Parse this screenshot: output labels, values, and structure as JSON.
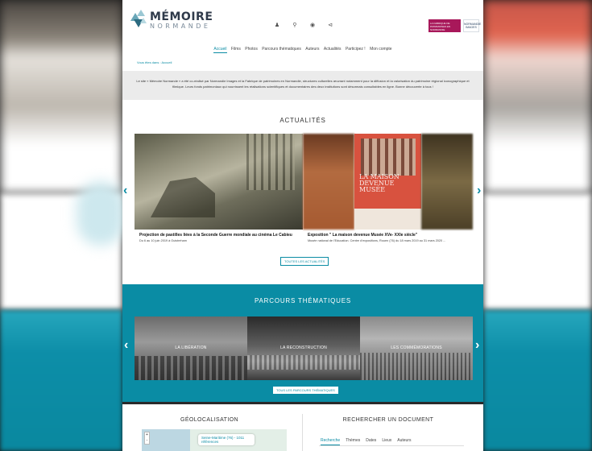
{
  "logo": {
    "title": "MÉMOIRE",
    "subtitle": "NORMANDE"
  },
  "header_icons": [
    "user-icon",
    "search-icon",
    "globe-icon",
    "share-icon"
  ],
  "partners": {
    "fabrique": "LA FABRIQUE DE PATRIMOINES EN NORMANDIE",
    "images": "NORMANDIE IMAGES"
  },
  "nav": {
    "items": [
      "Accueil",
      "Films",
      "Photos",
      "Parcours thématiques",
      "Auteurs",
      "Actualités",
      "Participez !",
      "Mon compte"
    ],
    "active": "Accueil"
  },
  "breadcrumb": {
    "prefix": "Vous êtes dans :",
    "current": "Accueil"
  },
  "intro": "Le site « Mémoire Normande » a été co-réalisé par Normandie Images et la Fabrique de patrimoines en Normandie, structures culturelles œuvrant notamment pour la diffusion et la valorisation du patrimoine régional iconographique et filmique. Leurs fonds patrimoniaux qui nourrissent les réalisations scientifiques et documentaires des deux institutions sont désormais consultables en ligne. Bonne découverte à tous !",
  "news": {
    "title": "ACTUALITÉS",
    "items": [
      {
        "title": "Projection de pastilles liées à la Seconde Guerre mondiale au cinéma Le Cabieu",
        "meta": "Du 6 au 10 juin 2019 à Ouistreham"
      },
      {
        "title": "Exposition \" La maison devenue Musée XVe- XXIe siècle\"",
        "meta": "Musée national de l'Education. Centre d'expositions, Rouen (76) du 18 mars 2019 au 31 mars 2020 ..."
      }
    ],
    "poster_text": "LA MAISON DEVENUE MUSÉE",
    "button": "TOUTES LES ACTUALITÉS",
    "prev_icon": "chevron-left-icon",
    "next_icon": "chevron-right-icon"
  },
  "parcours": {
    "title": "PARCOURS THÉMATIQUES",
    "tiles": [
      "LA LIBÉRATION",
      "LA RECONSTRUCTION",
      "LES COMMÉMORATIONS"
    ],
    "button": "TOUS LES PARCOURS THÉMATIQUES"
  },
  "geo": {
    "title": "GÉOLOCALISATION",
    "zoom_in": "+",
    "zoom_out": "-",
    "popup": "Seine-Maritime (76) - 1011 références"
  },
  "search": {
    "title": "RECHERCHER UN DOCUMENT",
    "tabs": [
      "Recherche",
      "Thèmes",
      "Dates",
      "Lieux",
      "Auteurs"
    ],
    "active": "Recherche"
  },
  "colors": {
    "accent": "#0a8ca4",
    "brand_partner": "#a8185a"
  }
}
